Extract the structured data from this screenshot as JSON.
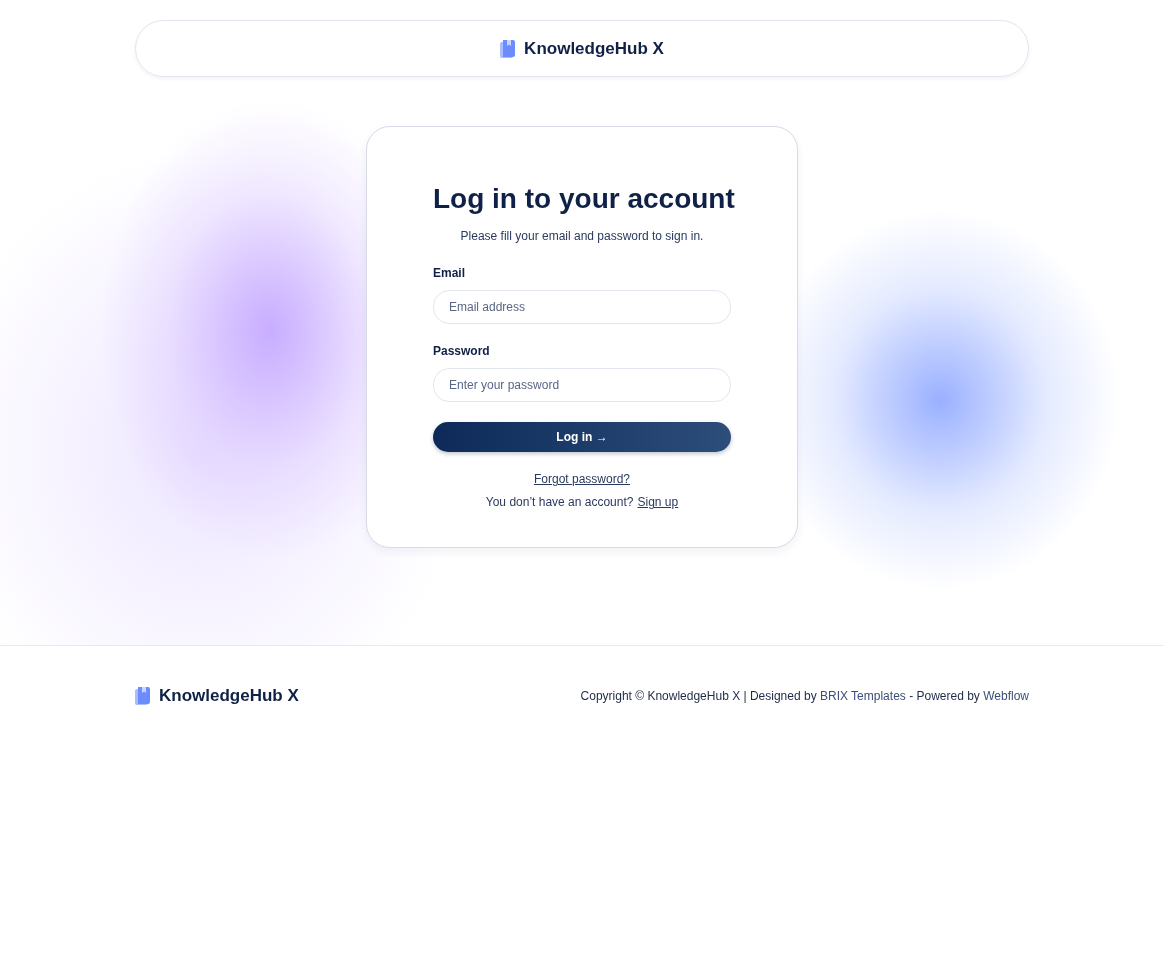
{
  "header": {
    "brand": "KnowledgeHub X"
  },
  "login": {
    "title": "Log in to your account",
    "subtitle": "Please fill your email and password to sign in.",
    "fields": [
      {
        "label": "Email",
        "placeholder": "Email address"
      },
      {
        "label": "Password",
        "placeholder": "Enter your password"
      }
    ],
    "submit": "Log in →",
    "forgot": "Forgot password?",
    "signup_prompt": "You don’t have an account?",
    "signup_link": "Sign up"
  },
  "footer": {
    "brand": "KnowledgeHub X",
    "copyright": "Copyright © KnowledgeHub X | Designed by",
    "designer_link": "BRIX Templates",
    "powered": "- Powered by",
    "powered_link": "Webflow"
  }
}
